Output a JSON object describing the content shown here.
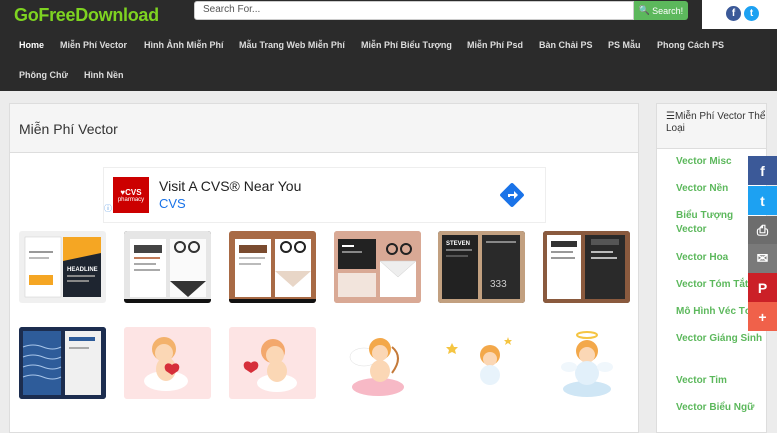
{
  "header": {
    "logo": "GoFreeDownload",
    "search_placeholder": "Search For...",
    "search_button": "Search!",
    "social": [
      {
        "name": "facebook",
        "glyph": "f",
        "color": "#3b5998"
      },
      {
        "name": "twitter",
        "glyph": "t",
        "color": "#1da1f2"
      }
    ]
  },
  "nav": [
    "Home",
    "Miễn Phí Vector",
    "Hình Ảnh Miễn Phí",
    "Mẫu Trang Web Miễn Phí",
    "Miễn Phí Biểu Tượng",
    "Miễn Phí Psd",
    "Bàn Chải PS",
    "PS Mẫu",
    "Phong Cách PS",
    "Phông Chữ",
    "Hình Nền"
  ],
  "main": {
    "title": "Miễn Phí Vector",
    "ad": {
      "logo_line1": "♥CVS",
      "logo_line2": "pharmacy",
      "title": "Visit A CVS® Near You",
      "subtitle": "CVS"
    }
  },
  "sidebar": {
    "title": "Miễn Phí Vector Thể Loại",
    "items": [
      "Vector Misc",
      "Vector Nền",
      "Biểu Tượng Vector",
      "Vector Hoa",
      "Vector Tóm Tắt",
      "Mô Hình Véc Tơ",
      "Vector Giáng Sinh",
      "Vector Tim",
      "Vector Biểu Ngữ"
    ]
  },
  "share": [
    {
      "name": "facebook",
      "glyph": "f",
      "color": "#3b5998"
    },
    {
      "name": "twitter",
      "glyph": "t",
      "color": "#1da1f2"
    },
    {
      "name": "print",
      "glyph": "⎙",
      "color": "#6d6d6d"
    },
    {
      "name": "email",
      "glyph": "✉",
      "color": "#7a7a7a"
    },
    {
      "name": "pinterest",
      "glyph": "P",
      "color": "#cb2027"
    },
    {
      "name": "more",
      "glyph": "+",
      "color": "#f0614a"
    }
  ],
  "thumb_text": {
    "headline": "HEADLINE",
    "steven": "STEVEN",
    "num": "333"
  }
}
